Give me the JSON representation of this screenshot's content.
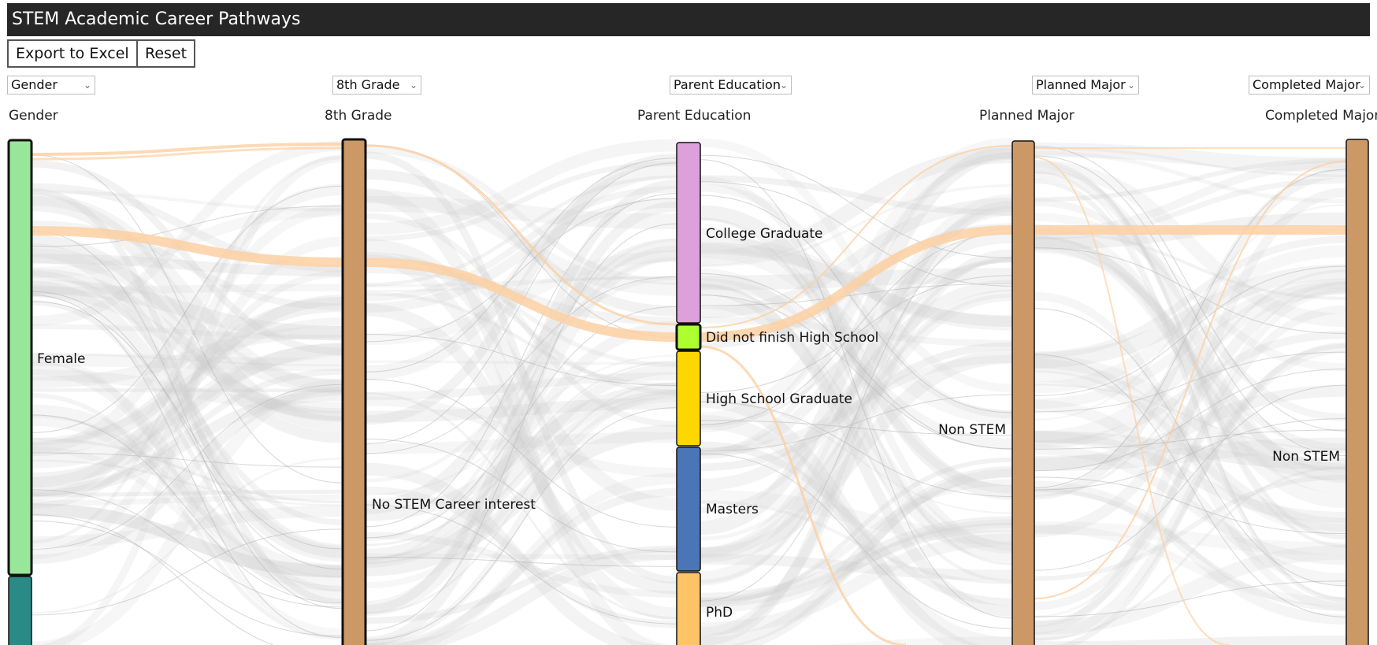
{
  "header": {
    "title": "STEM Academic Career Pathways"
  },
  "toolbar": {
    "export_label": "Export to Excel",
    "reset_label": "Reset"
  },
  "dropdowns": [
    {
      "selected": "Gender"
    },
    {
      "selected": "8th Grade"
    },
    {
      "selected": "Parent Education"
    },
    {
      "selected": "Planned Major"
    },
    {
      "selected": "Completed Major"
    }
  ],
  "colors": {
    "highlight_flow": "#fdd0a2",
    "background_flow": "#cccccc",
    "female": "#98e698",
    "male_partial": "#2a8a86",
    "no_stem": "#cc9966",
    "college_graduate": "#dda0dd",
    "did_not_finish_hs": "#adff2f",
    "hs_graduate": "#ffd700",
    "masters": "#4a76b8",
    "phd": "#ffc466"
  },
  "chart_data": {
    "type": "sankey",
    "title": "STEM Academic Career Pathways",
    "axes": [
      "Gender",
      "8th Grade",
      "Parent Education",
      "Planned Major",
      "Completed Major"
    ],
    "nodes": [
      {
        "axis": "Gender",
        "label": "Female",
        "color_key": "female",
        "selected": true
      },
      {
        "axis": "Gender",
        "label": "",
        "color_key": "male_partial",
        "selected": false
      },
      {
        "axis": "8th Grade",
        "label": "No STEM Career interest",
        "color_key": "no_stem",
        "selected": true
      },
      {
        "axis": "Parent Education",
        "label": "College Graduate",
        "color_key": "college_graduate",
        "selected": false
      },
      {
        "axis": "Parent Education",
        "label": "Did not finish High School",
        "color_key": "did_not_finish_hs",
        "selected": true
      },
      {
        "axis": "Parent Education",
        "label": "High School Graduate",
        "color_key": "hs_graduate",
        "selected": false
      },
      {
        "axis": "Parent Education",
        "label": "Masters",
        "color_key": "masters",
        "selected": false
      },
      {
        "axis": "Parent Education",
        "label": "PhD",
        "color_key": "phd",
        "selected": false
      },
      {
        "axis": "Planned Major",
        "label": "Non STEM",
        "color_key": "no_stem",
        "selected": false
      },
      {
        "axis": "Completed Major",
        "label": "Non STEM",
        "color_key": "no_stem",
        "selected": false
      }
    ],
    "highlighted_path": [
      "Female",
      "No STEM Career interest",
      "Did not finish High School",
      "Non STEM",
      "Non STEM"
    ]
  }
}
